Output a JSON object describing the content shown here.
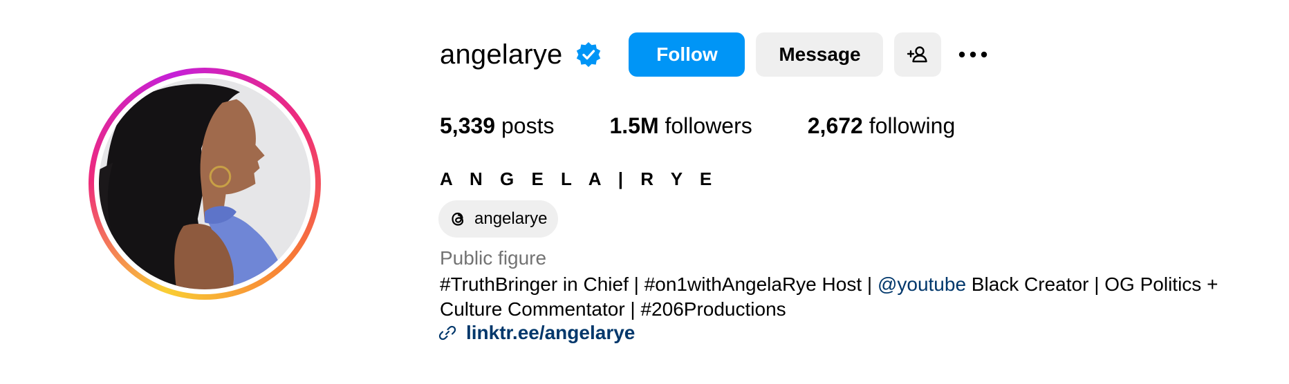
{
  "profile": {
    "username": "angelarye",
    "verified_icon": "verified-badge-icon",
    "full_name": "A N G E L A | R Y E",
    "threads_handle": "angelarye",
    "category": "Public figure",
    "bio_part1": "#TruthBringer in Chief | #on1withAngelaRye Host | ",
    "bio_mention": "@youtube",
    "bio_part2": " Black Creator | OG Politics + Culture Commentator | #206Productions",
    "link": "linktr.ee/angelarye"
  },
  "actions": {
    "follow_label": "Follow",
    "message_label": "Message",
    "add_user_icon": "add-user-icon",
    "more_icon": "more-options-icon"
  },
  "stats": {
    "posts_count": "5,339",
    "posts_label": " posts",
    "followers_count": "1.5M",
    "followers_label": " followers",
    "following_count": "2,672",
    "following_label": " following"
  },
  "colors": {
    "follow_button": "#0095f6",
    "secondary_button": "#efefef",
    "link": "#00376b",
    "category": "#737373",
    "verified": "#0095f6"
  }
}
